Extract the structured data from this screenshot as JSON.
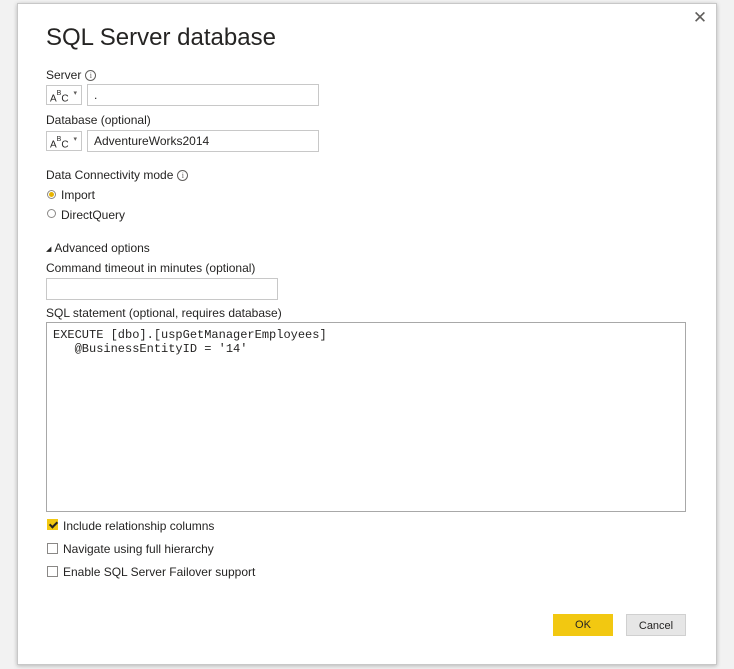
{
  "dialog": {
    "title": "SQL Server database",
    "close_glyph": "✕",
    "close_icon": "close-icon"
  },
  "server": {
    "label": "Server",
    "info_glyph": "i",
    "type_icon": "abc-text-type-icon",
    "type_a": "A",
    "type_b": "B",
    "type_c": "C",
    "chevron": "▾",
    "value": "."
  },
  "database": {
    "label": "Database (optional)",
    "type_a": "A",
    "type_b": "B",
    "type_c": "C",
    "chevron": "▾",
    "value": "AdventureWorks2014"
  },
  "connectivity": {
    "label": "Data Connectivity mode",
    "info_glyph": "i",
    "options": [
      {
        "label": "Import",
        "selected": true
      },
      {
        "label": "DirectQuery",
        "selected": false
      }
    ]
  },
  "advanced": {
    "toggle_glyph": "◢",
    "label": "Advanced options",
    "timeout_label": "Command timeout in minutes (optional)",
    "timeout_value": "",
    "sql_label": "SQL statement (optional, requires database)",
    "sql_value": "EXECUTE [dbo].[uspGetManagerEmployees]\n   @BusinessEntityID = '14'",
    "checkboxes": [
      {
        "label": "Include relationship columns",
        "checked": true
      },
      {
        "label": "Navigate using full hierarchy",
        "checked": false
      },
      {
        "label": "Enable SQL Server Failover support",
        "checked": false
      }
    ]
  },
  "buttons": {
    "ok": "OK",
    "cancel": "Cancel"
  },
  "colors": {
    "accent": "#f2c811",
    "radio_selected": "#e8b400"
  }
}
